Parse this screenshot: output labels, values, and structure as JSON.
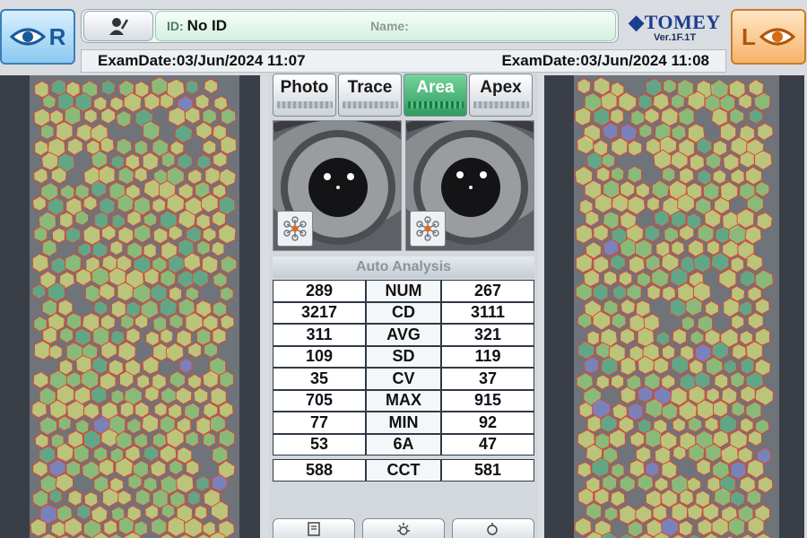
{
  "right_eye": {
    "label": "R",
    "icon": "eye-icon"
  },
  "left_eye": {
    "label": "L",
    "icon": "eye-icon"
  },
  "patient": {
    "icon": "patient-icon",
    "id_label": "ID:",
    "id_value": "No ID",
    "name_label": "Name:",
    "name_value": ""
  },
  "logo": {
    "brand": "TOMEY",
    "version": "Ver.1F.1T"
  },
  "exam": {
    "right_date": "ExamDate:03/Jun/2024 11:07",
    "left_date": "ExamDate:03/Jun/2024 11:08"
  },
  "tabs": [
    {
      "label": "Photo",
      "active": false
    },
    {
      "label": "Trace",
      "active": false
    },
    {
      "label": "Area",
      "active": true
    },
    {
      "label": "Apex",
      "active": false
    }
  ],
  "analysis": {
    "title": "Auto Analysis",
    "rows": [
      {
        "right": "289",
        "label": "NUM",
        "left": "267"
      },
      {
        "right": "3217",
        "label": "CD",
        "left": "3111"
      },
      {
        "right": "311",
        "label": "AVG",
        "left": "321"
      },
      {
        "right": "109",
        "label": "SD",
        "left": "119"
      },
      {
        "right": "35",
        "label": "CV",
        "left": "37"
      },
      {
        "right": "705",
        "label": "MAX",
        "left": "915"
      },
      {
        "right": "77",
        "label": "MIN",
        "left": "92"
      },
      {
        "right": "53",
        "label": "6A",
        "left": "47"
      }
    ],
    "cct": {
      "right": "588",
      "label": "CCT",
      "left": "581"
    }
  },
  "bottom_buttons": [
    {
      "icon": "print-icon"
    },
    {
      "icon": "brightness-icon"
    },
    {
      "icon": "search-icon"
    }
  ],
  "colors": {
    "active_tab": "#3aa86a",
    "right_accent": "#3a7fb8",
    "left_accent": "#e48a2a",
    "cell_outline": "#d84a3a"
  }
}
